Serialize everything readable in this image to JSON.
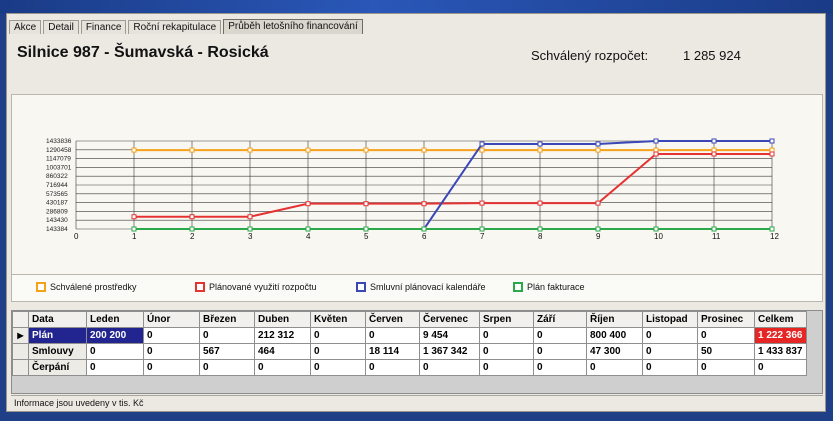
{
  "tabs": [
    {
      "label": "Akce",
      "active": false
    },
    {
      "label": "Detail",
      "active": false
    },
    {
      "label": "Finance",
      "active": false
    },
    {
      "label": "Roční rekapitulace",
      "active": false
    },
    {
      "label": "Průběh letošního financování",
      "active": true
    }
  ],
  "header": {
    "title": "Silnice 987 - Šumavská - Rosická",
    "budget_label": "Schválený rozpočet:",
    "budget_value": "1 285 924"
  },
  "chart_data": {
    "type": "line",
    "x": [
      0,
      1,
      2,
      3,
      4,
      5,
      6,
      7,
      8,
      9,
      10,
      11,
      12
    ],
    "xlim": [
      0,
      12
    ],
    "y_tick_labels": [
      "1433836",
      "1290458",
      "1147079",
      "1003701",
      "860322",
      "716944",
      "573565",
      "430187",
      "286809",
      "143430"
    ],
    "y_bottom_label": "143384",
    "series": [
      {
        "name": "Schválené prostředky",
        "color": "#f5a21b",
        "values": [
          null,
          1285924,
          1285924,
          1285924,
          1285924,
          1285924,
          1285924,
          1285924,
          1285924,
          1285924,
          1285924,
          1285924,
          1285924
        ]
      },
      {
        "name": "Plánované využití rozpočtu",
        "color": "#e53333",
        "values": [
          null,
          200200,
          200200,
          200200,
          412512,
          412512,
          412512,
          421966,
          421966,
          421966,
          1222366,
          1222366,
          1222366
        ]
      },
      {
        "name": "Smluvní plánovací kalendáře",
        "color": "#3a47b7",
        "values": [
          null,
          0,
          0,
          0,
          0,
          0,
          0,
          1385456,
          1385456,
          1385456,
          1433837,
          1433837,
          1433837
        ]
      },
      {
        "name": "Plán fakturace",
        "color": "#2aa84a",
        "values": [
          null,
          0,
          0,
          0,
          0,
          0,
          0,
          0,
          0,
          0,
          0,
          0,
          0
        ]
      }
    ],
    "ylim": [
      0,
      1433836
    ],
    "grid": true
  },
  "table": {
    "columns": [
      "Data",
      "Leden",
      "Únor",
      "Březen",
      "Duben",
      "Květen",
      "Červen",
      "Červenec",
      "Srpen",
      "Září",
      "Říjen",
      "Listopad",
      "Prosinec",
      "Celkem"
    ],
    "rows": [
      {
        "selected": true,
        "cells": [
          "Plán",
          "200 200",
          "0",
          "0",
          "212 312",
          "0",
          "0",
          "9 454",
          "0",
          "0",
          "800 400",
          "0",
          "0",
          "1 222 366"
        ]
      },
      {
        "selected": false,
        "cells": [
          "Smlouvy",
          "0",
          "0",
          "567",
          "464",
          "0",
          "18 114",
          "1 367 342",
          "0",
          "0",
          "47 300",
          "0",
          "50",
          "1 433 837"
        ]
      },
      {
        "selected": false,
        "cells": [
          "Čerpání",
          "0",
          "0",
          "0",
          "0",
          "0",
          "0",
          "0",
          "0",
          "0",
          "0",
          "0",
          "0",
          "0"
        ]
      }
    ]
  },
  "footer": {
    "note": "Informace jsou uvedeny v tis. Kč"
  },
  "icons": {
    "row_pointer": "row-pointer-icon"
  }
}
